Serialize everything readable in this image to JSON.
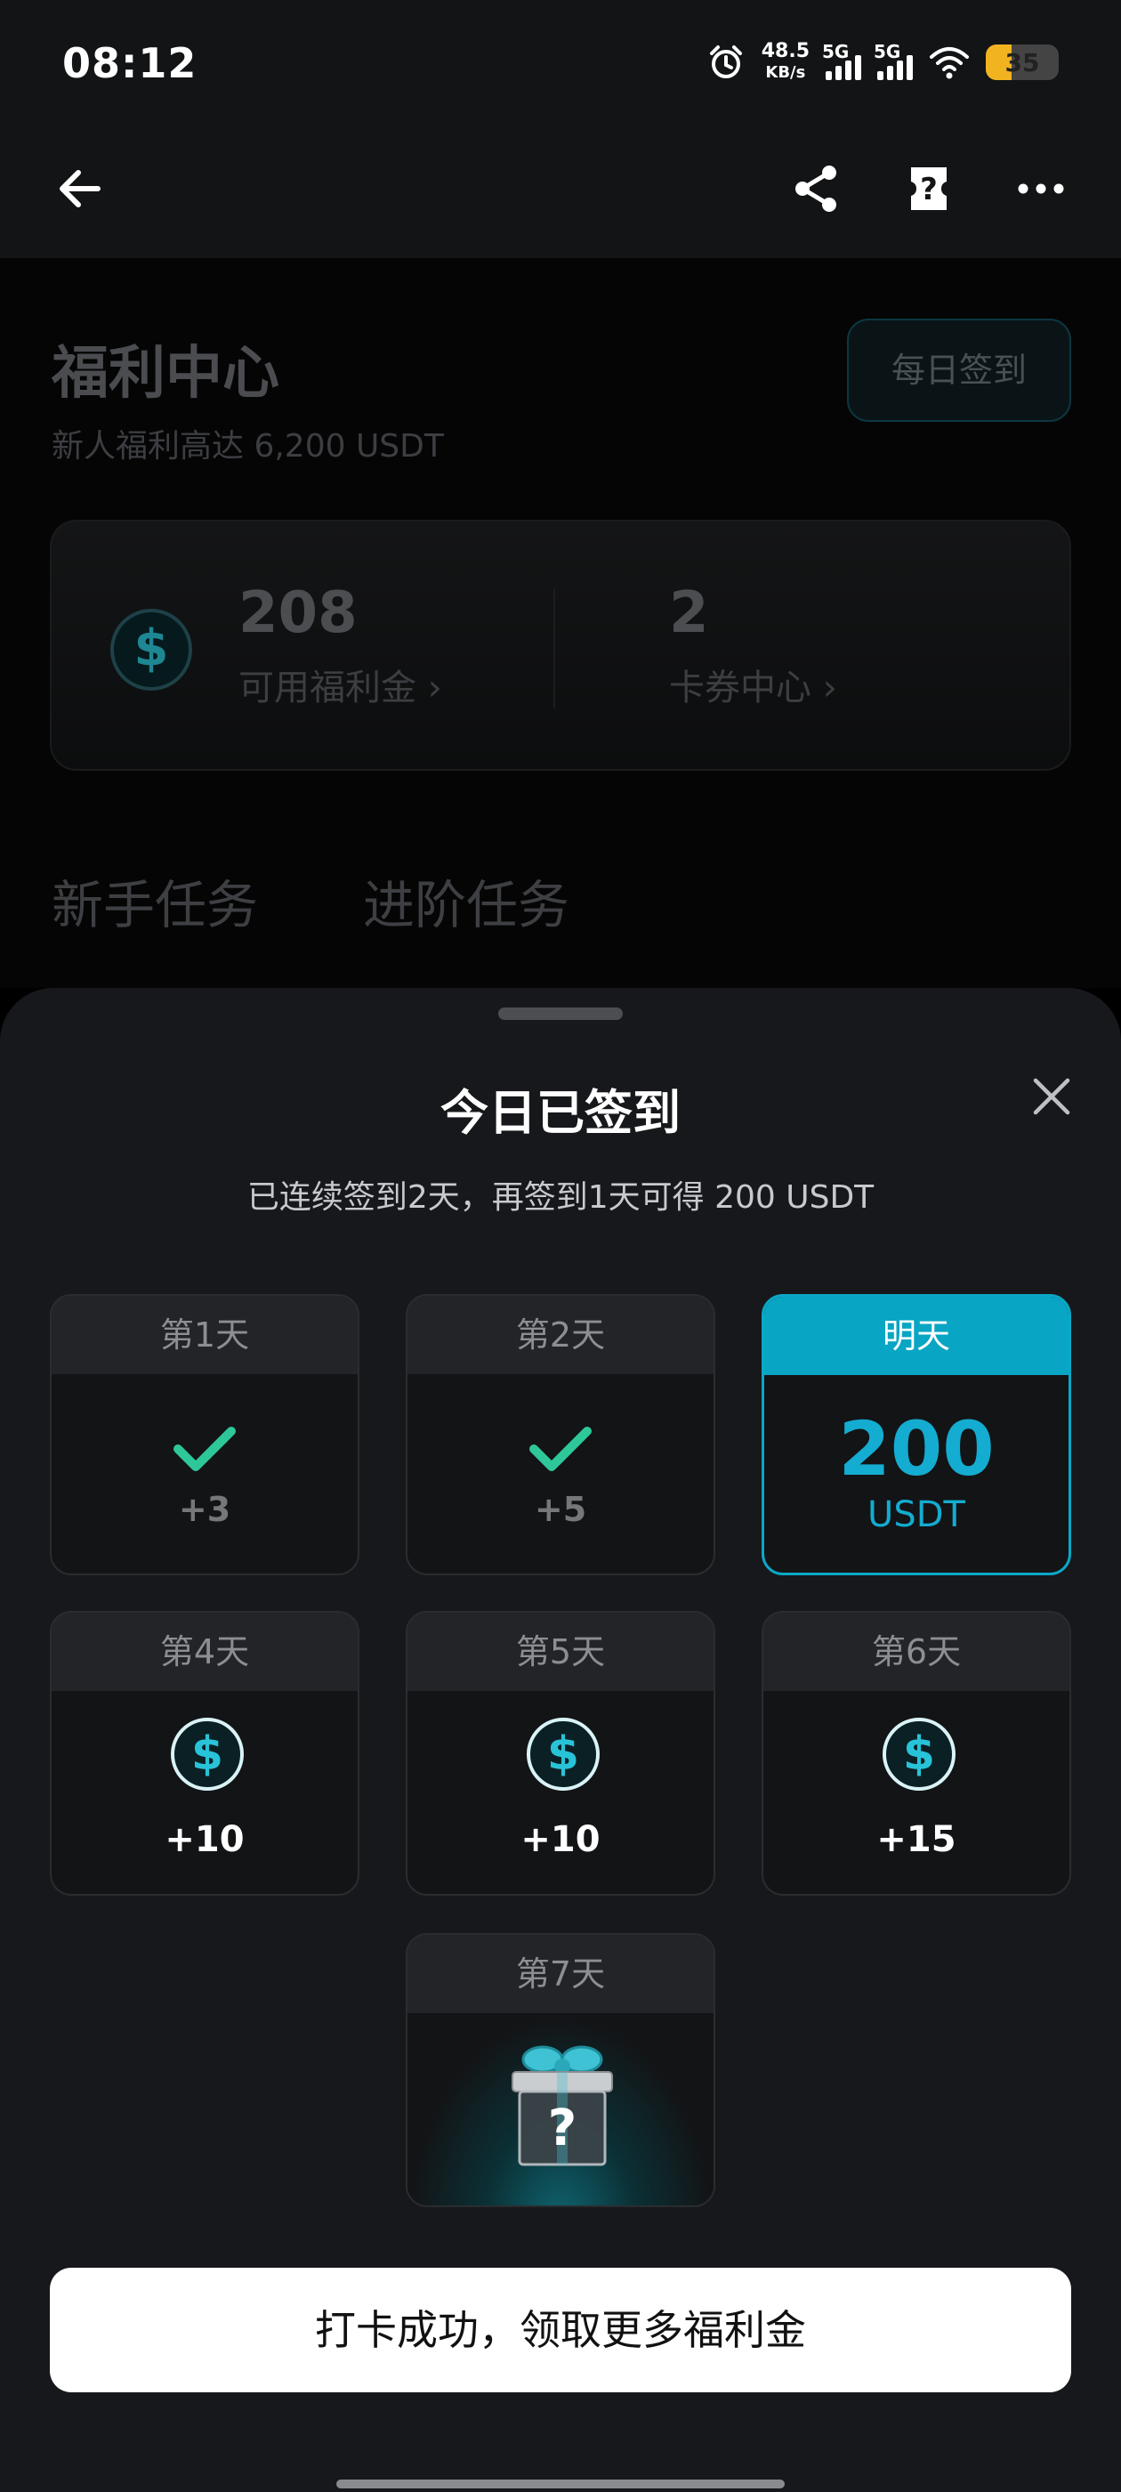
{
  "status_bar": {
    "time": "08:12",
    "net_speed": "48.5",
    "net_unit": "KB/s",
    "sim1": "5G",
    "sim2": "5G",
    "battery": "35"
  },
  "nav": {
    "back_icon": "arrow-left-icon",
    "share_icon": "share-icon",
    "help_icon": "help-icon",
    "more_icon": "more-icon"
  },
  "page": {
    "title": "福利中心",
    "subtitle": "新人福利高达 6,200 USDT",
    "daily_checkin_button": "每日签到",
    "welfare": {
      "balance": "208",
      "balance_label": "可用福利金 ›",
      "coupons": "2",
      "coupons_label": "卡券中心 ›"
    },
    "tabs": [
      "新手任务",
      "进阶任务"
    ]
  },
  "sheet": {
    "title": "今日已签到",
    "subtitle": "已连续签到2天，再签到1天可得 200 USDT",
    "days": [
      {
        "label": "第1天",
        "reward": "+3",
        "state": "done"
      },
      {
        "label": "第2天",
        "reward": "+5",
        "state": "done"
      },
      {
        "label": "明天",
        "reward": "200",
        "unit": "USDT",
        "state": "tomorrow"
      },
      {
        "label": "第4天",
        "reward": "+10",
        "state": "pending"
      },
      {
        "label": "第5天",
        "reward": "+10",
        "state": "pending"
      },
      {
        "label": "第6天",
        "reward": "+15",
        "state": "pending"
      },
      {
        "label": "第7天",
        "reward": "",
        "state": "mystery"
      }
    ],
    "cta": "打卡成功，领取更多福利金"
  },
  "colors": {
    "accent": "#09a5c4",
    "check_green": "#2ec79a",
    "sheet_bg": "#17181b"
  }
}
